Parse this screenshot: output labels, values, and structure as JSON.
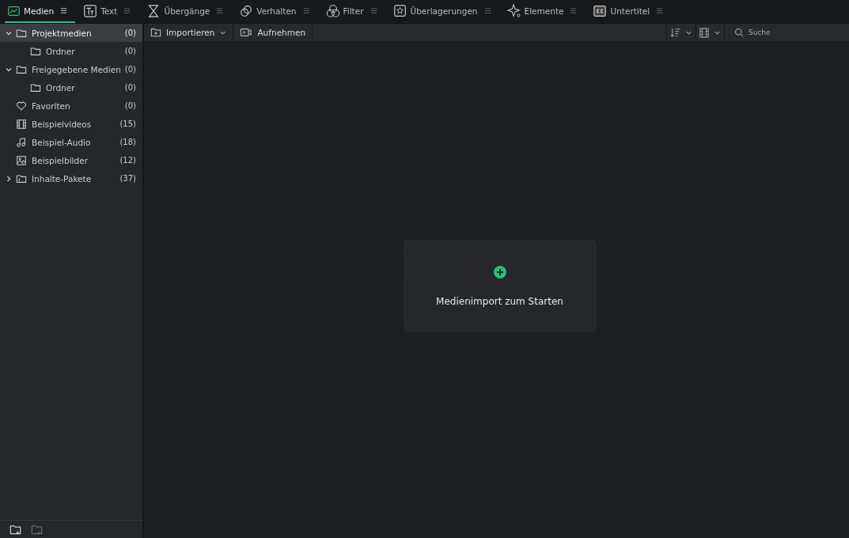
{
  "tabs": [
    {
      "label": "Medien",
      "selected": true
    },
    {
      "label": "Text",
      "selected": false
    },
    {
      "label": "Übergänge",
      "selected": false
    },
    {
      "label": "Verhalten",
      "selected": false
    },
    {
      "label": "Filter",
      "selected": false
    },
    {
      "label": "Überlagerungen",
      "selected": false
    },
    {
      "label": "Elemente",
      "selected": false
    },
    {
      "label": "Untertitel",
      "selected": false
    }
  ],
  "sidebar": {
    "items": [
      {
        "label": "Projektmedien",
        "count": "(0)",
        "kind": "folder",
        "expanded": true,
        "selected": true,
        "children": [
          {
            "label": "Ordner",
            "count": "(0)",
            "kind": "folder",
            "selected": false
          }
        ]
      },
      {
        "label": "Freigegebene Medien",
        "count": "(0)",
        "kind": "folder",
        "expanded": true,
        "selected": false,
        "children": [
          {
            "label": "Ordner",
            "count": "(0)",
            "kind": "folder",
            "selected": false
          }
        ]
      },
      {
        "label": "Favoriten",
        "count": "(0)",
        "kind": "heart",
        "selected": false
      },
      {
        "label": "Beispielvideos",
        "count": "(15)",
        "kind": "film",
        "selected": false
      },
      {
        "label": "Beispiel-Audio",
        "count": "(18)",
        "kind": "music",
        "selected": false
      },
      {
        "label": "Beispielbilder",
        "count": "(12)",
        "kind": "image",
        "selected": false
      },
      {
        "label": "Inhalte-Pakete",
        "count": "(37)",
        "kind": "package",
        "expanded": false,
        "selected": false
      }
    ],
    "footer_buttons": [
      {
        "kind": "new-folder",
        "disabled": false
      },
      {
        "kind": "remove-folder",
        "disabled": true
      }
    ]
  },
  "toolbar": {
    "import_button": "Importieren",
    "record_button": "Aufnehmen",
    "search": {
      "placeholder": "Suche"
    }
  },
  "empty_state": {
    "text": "Medienimport zum Starten"
  }
}
